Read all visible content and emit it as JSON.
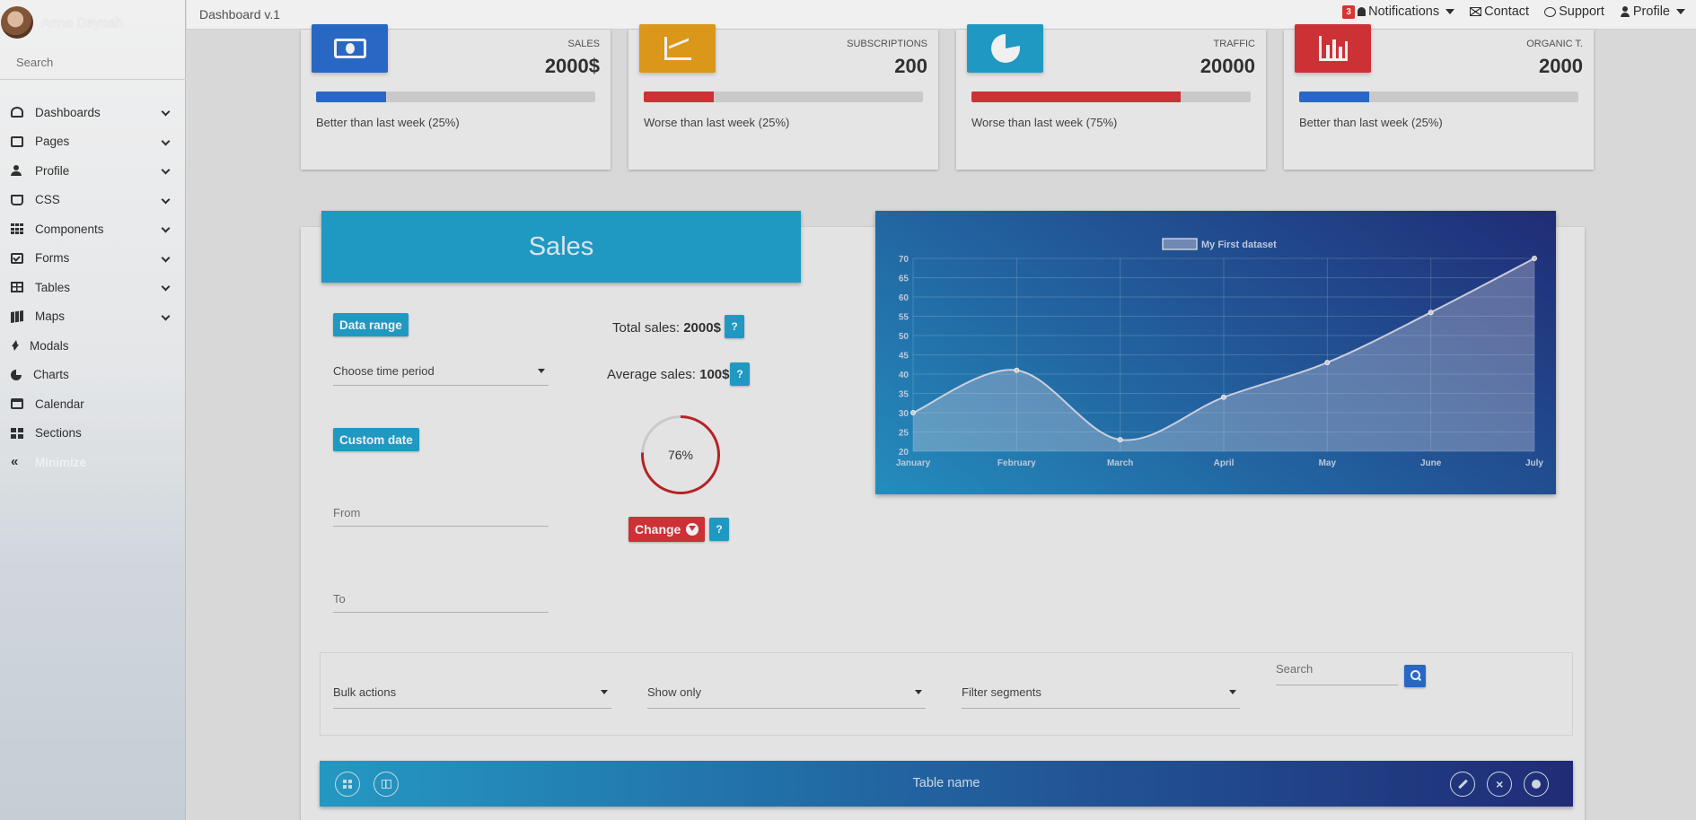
{
  "sidebar": {
    "user_name": "Anna Deynah",
    "search_placeholder": "Search",
    "items": [
      {
        "label": "Dashboards",
        "icon": "gauge-icon",
        "has_submenu": true
      },
      {
        "label": "Pages",
        "icon": "image-icon",
        "has_submenu": true
      },
      {
        "label": "Profile",
        "icon": "user-icon",
        "has_submenu": true
      },
      {
        "label": "CSS",
        "icon": "css3-icon",
        "has_submenu": true
      },
      {
        "label": "Components",
        "icon": "grid-icon",
        "has_submenu": true
      },
      {
        "label": "Forms",
        "icon": "check-square-icon",
        "has_submenu": true
      },
      {
        "label": "Tables",
        "icon": "table-icon",
        "has_submenu": true
      },
      {
        "label": "Maps",
        "icon": "map-icon",
        "has_submenu": true
      },
      {
        "label": "Modals",
        "icon": "bolt-icon",
        "has_submenu": false
      },
      {
        "label": "Charts",
        "icon": "pie-chart-icon",
        "has_submenu": false
      },
      {
        "label": "Calendar",
        "icon": "calendar-check-icon",
        "has_submenu": false
      },
      {
        "label": "Sections",
        "icon": "th-large-icon",
        "has_submenu": false
      },
      {
        "label": "Minimize",
        "icon": "double-chevron-left-icon",
        "has_submenu": false
      }
    ]
  },
  "topbar": {
    "title": "Dashboard v.1",
    "notifications": {
      "count": "3",
      "label": "Notifications"
    },
    "contact": "Contact",
    "support": "Support",
    "profile": "Profile"
  },
  "stats": [
    {
      "label": "SALES",
      "value": "2000$",
      "progress": 0.25,
      "bar_color": "#2b6fd1",
      "desc": "Better than last week (25%)",
      "icon": "money-bill-icon",
      "icon_bg": "#2b6fd1"
    },
    {
      "label": "SUBSCRIPTIONS",
      "value": "200",
      "progress": 0.25,
      "bar_color": "#d9353a",
      "desc": "Worse than last week (25%)",
      "icon": "line-chart-icon",
      "icon_bg": "#e8a11c"
    },
    {
      "label": "TRAFFIC",
      "value": "20000",
      "progress": 0.75,
      "bar_color": "#d9353a",
      "desc": "Worse than last week (75%)",
      "icon": "pie-chart-icon",
      "icon_bg": "#23a3cf"
    },
    {
      "label": "ORGANIC T.",
      "value": "2000",
      "progress": 0.25,
      "bar_color": "#2b6fd1",
      "desc": "Better than last week (25%)",
      "icon": "bar-chart-icon",
      "icon_bg": "#d9353a"
    }
  ],
  "sales": {
    "title": "Sales",
    "data_range": "Data range",
    "time_period": "Choose time period",
    "custom_date": "Custom date",
    "from_placeholder": "From",
    "to_placeholder": "To",
    "total_label": "Total sales:",
    "total_value": "2000$",
    "avg_label": "Average sales:",
    "avg_value": "100$",
    "help": "?",
    "ring_value": 76,
    "ring_label": "76%",
    "change": "Change"
  },
  "chart_data": {
    "type": "line",
    "categories": [
      "January",
      "February",
      "March",
      "April",
      "May",
      "June",
      "July"
    ],
    "series": [
      {
        "name": "My First dataset",
        "values": [
          30,
          41,
          23,
          34,
          43,
          56,
          70
        ]
      }
    ],
    "ylim": [
      20,
      70
    ],
    "yticks": [
      20,
      25,
      30,
      35,
      40,
      45,
      50,
      55,
      60,
      65,
      70
    ],
    "legend": "top",
    "grid": true
  },
  "filters": {
    "bulk": "Bulk actions",
    "show_only": "Show only",
    "segments": "Filter segments",
    "search_placeholder": "Search"
  },
  "table": {
    "title": "Table name"
  }
}
